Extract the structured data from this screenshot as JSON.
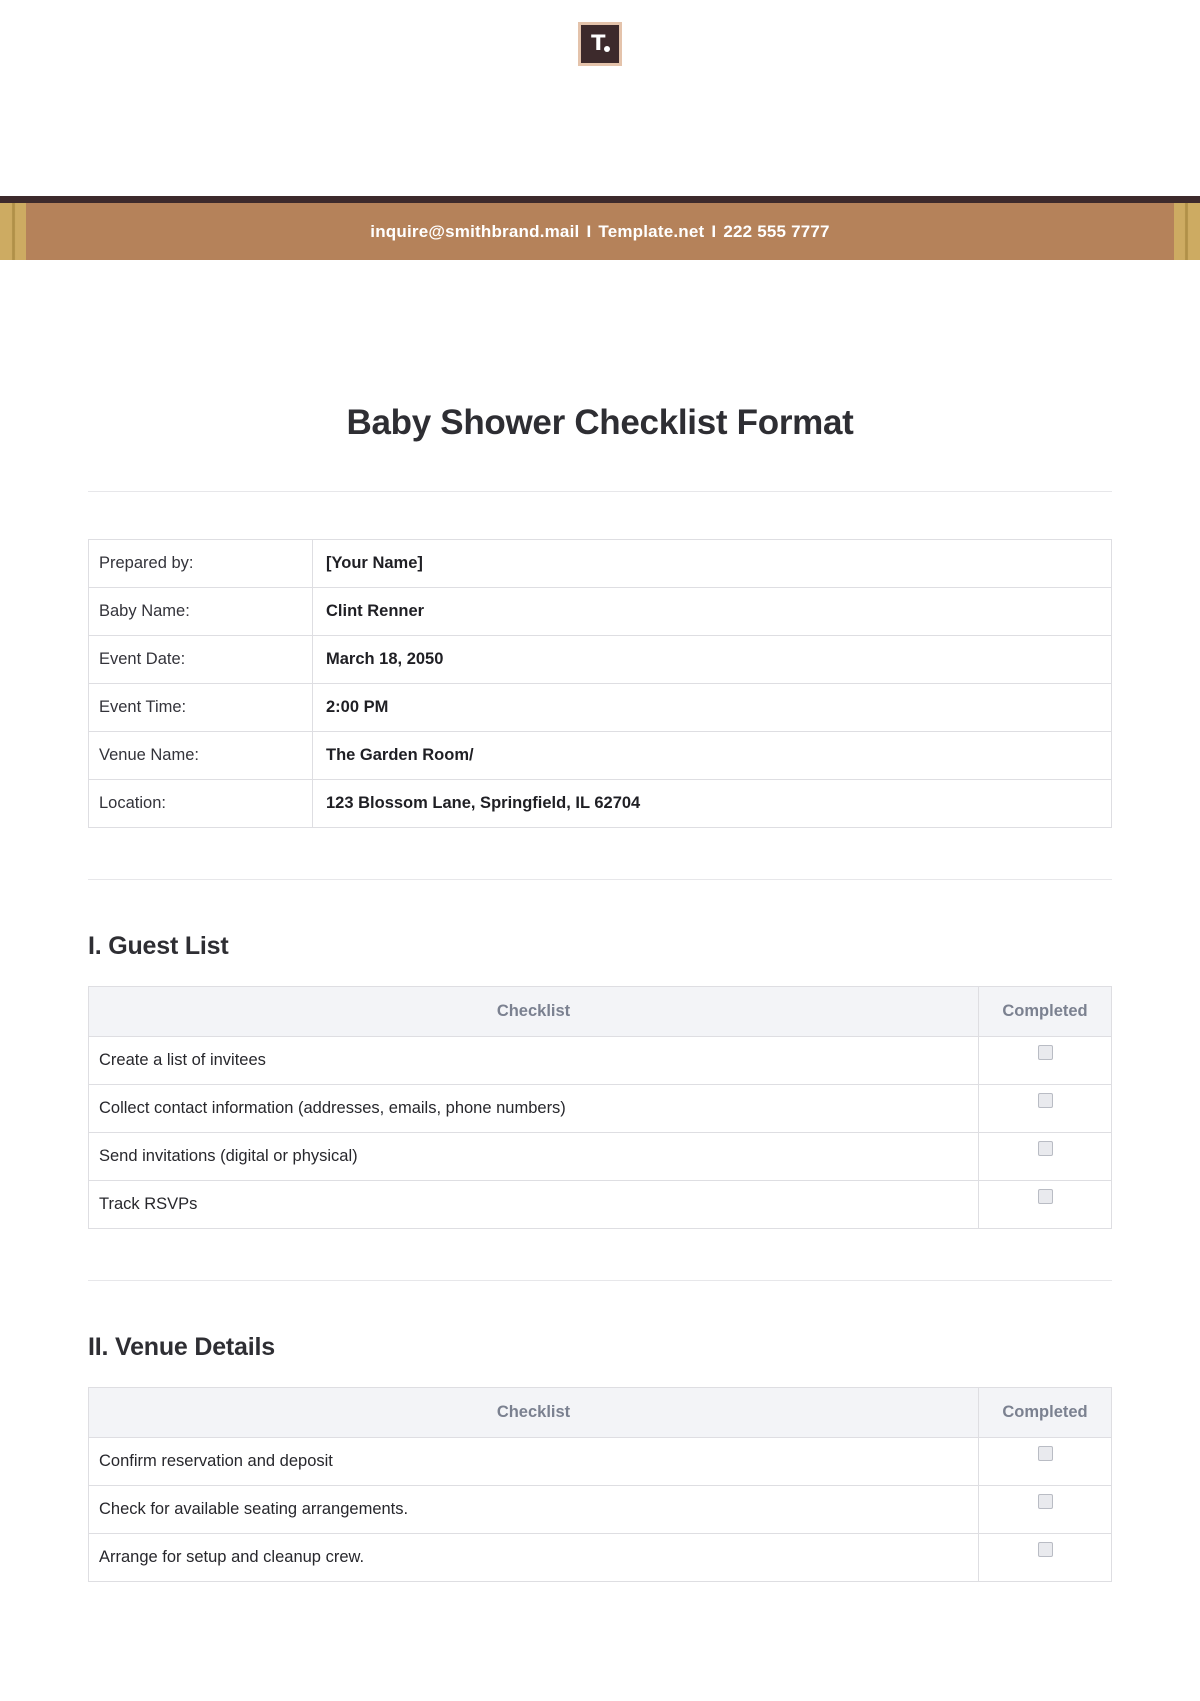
{
  "brand": {
    "logo_letter": "T",
    "logo_name": "template-net-logo"
  },
  "banner": {
    "email": "inquire@smithbrand.mail",
    "separator": "I",
    "website": "Template.net",
    "phone": "222 555 7777",
    "background_color": "#b5825a",
    "top_border_color": "#3d2a2c",
    "stripe_color": "#cdab62"
  },
  "document": {
    "title": "Baby Shower Checklist Format"
  },
  "info_table": {
    "rows": [
      {
        "label": "Prepared by:",
        "value": "[Your Name]"
      },
      {
        "label": "Baby Name:",
        "value": "Clint Renner"
      },
      {
        "label": "Event Date:",
        "value": "March 18, 2050"
      },
      {
        "label": "Event Time:",
        "value": "2:00 PM"
      },
      {
        "label": "Venue Name:",
        "value": "The Garden Room/"
      },
      {
        "label": "Location:",
        "value": "123 Blossom Lane, Springfield, IL 62704"
      }
    ]
  },
  "columns": {
    "task": "Checklist",
    "completed": "Completed"
  },
  "sections": [
    {
      "heading": "I. Guest List",
      "items": [
        "Create a list of invitees",
        "Collect contact information (addresses, emails, phone numbers)",
        "Send invitations (digital or physical)",
        "Track RSVPs"
      ]
    },
    {
      "heading": "II. Venue Details",
      "items": [
        "Confirm reservation and deposit",
        "Check for available seating arrangements.",
        "Arrange for setup and cleanup crew."
      ]
    }
  ]
}
